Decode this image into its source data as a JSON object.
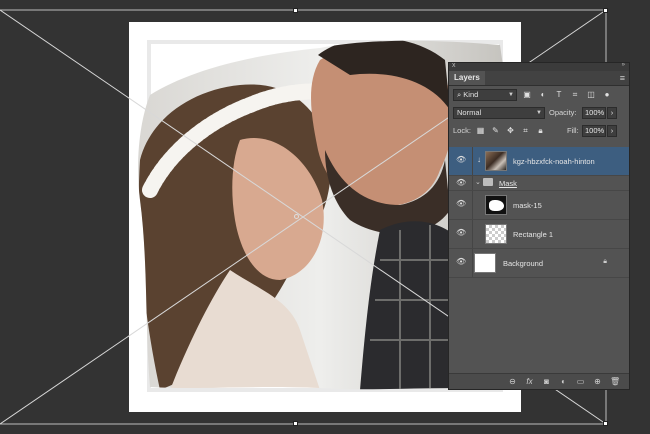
{
  "panel": {
    "close_symbol": "x",
    "collapse_symbol": "»",
    "tab_label": "Layers",
    "menu_icon": "≡"
  },
  "filter": {
    "kind_label": "Kind",
    "icons": [
      "image-filter-icon",
      "adjustment-filter-icon",
      "type-filter-icon",
      "shape-filter-icon",
      "smart-object-filter-icon",
      "filter-toggle-icon"
    ]
  },
  "blend": {
    "mode": "Normal",
    "opacity_label": "Opacity:",
    "opacity_value": "100%"
  },
  "lock": {
    "label": "Lock:",
    "fill_label": "Fill:",
    "fill_value": "100%"
  },
  "layers": [
    {
      "name": "kgz-hbzxfck-noah-hinton",
      "thumb": "photo",
      "selected": true,
      "clipped": true
    },
    {
      "name": "Mask",
      "type": "group"
    },
    {
      "name": "mask-15",
      "thumb": "mask"
    },
    {
      "name": "Rectangle 1",
      "thumb": "checker"
    },
    {
      "name": "Background",
      "thumb": "white",
      "locked": true
    }
  ],
  "bottom_icons": [
    "link-icon",
    "fx-icon",
    "add-mask-icon",
    "adjustment-layer-icon",
    "new-group-icon",
    "new-layer-icon",
    "delete-icon"
  ],
  "colors": {
    "workspace": "#333333",
    "panel": "#535353",
    "selected_layer": "#3d5e80"
  }
}
